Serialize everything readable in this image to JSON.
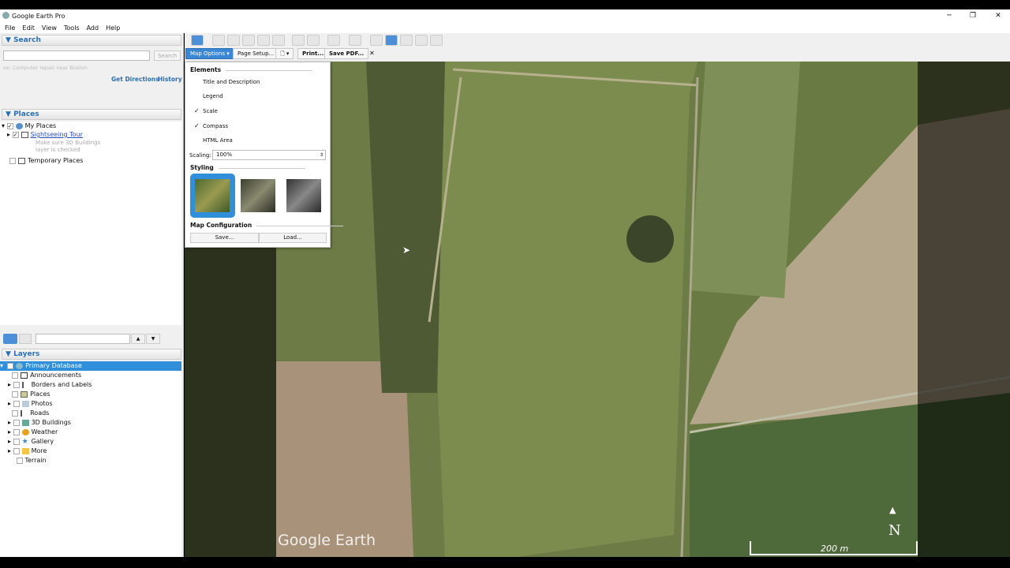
{
  "window": {
    "title": "Google Earth Pro",
    "minimize": "─",
    "restore": "❐",
    "close": "✕"
  },
  "menu": [
    "File",
    "Edit",
    "View",
    "Tools",
    "Add",
    "Help"
  ],
  "search": {
    "header": "Search",
    "placeholder": "",
    "button": "Search",
    "hint": "ex: Computer repair near Boston",
    "get_directions": "Get Directions",
    "history": "History"
  },
  "places": {
    "header": "Places",
    "items": [
      {
        "label": "My Places",
        "checked": true
      },
      {
        "label": "Sightseeing Tour",
        "checked": true,
        "note1": "Make sure 3D Buildings",
        "note2": "layer is checked"
      },
      {
        "label": "Temporary Places",
        "checked": false
      }
    ]
  },
  "layers": {
    "header": "Layers",
    "search_value": "",
    "up": "▲",
    "down": "▼",
    "root": "Primary Database",
    "items": [
      "Announcements",
      "Borders and Labels",
      "Places",
      "Photos",
      "Roads",
      "3D Buildings",
      "Weather",
      "Gallery",
      "More",
      "Terrain"
    ]
  },
  "print_toolbar": {
    "map_options": "Map Options",
    "page_setup": "Page Setup...",
    "print": "Print...",
    "save_pdf": "Save PDF...",
    "close": "✕"
  },
  "map_options": {
    "elements_header": "Elements",
    "elements": [
      {
        "label": "Title and Description",
        "checked": false
      },
      {
        "label": "Legend",
        "checked": false
      },
      {
        "label": "Scale",
        "checked": true
      },
      {
        "label": "Compass",
        "checked": true
      },
      {
        "label": "HTML Area",
        "checked": false
      }
    ],
    "scaling_label": "Scaling:",
    "scaling_value": "100%",
    "styling_header": "Styling",
    "selected_style": 0,
    "config_header": "Map Configuration",
    "save": "Save...",
    "load": "Load..."
  },
  "map": {
    "watermark": "Google Earth",
    "compass": "N",
    "scale": "200 m"
  }
}
